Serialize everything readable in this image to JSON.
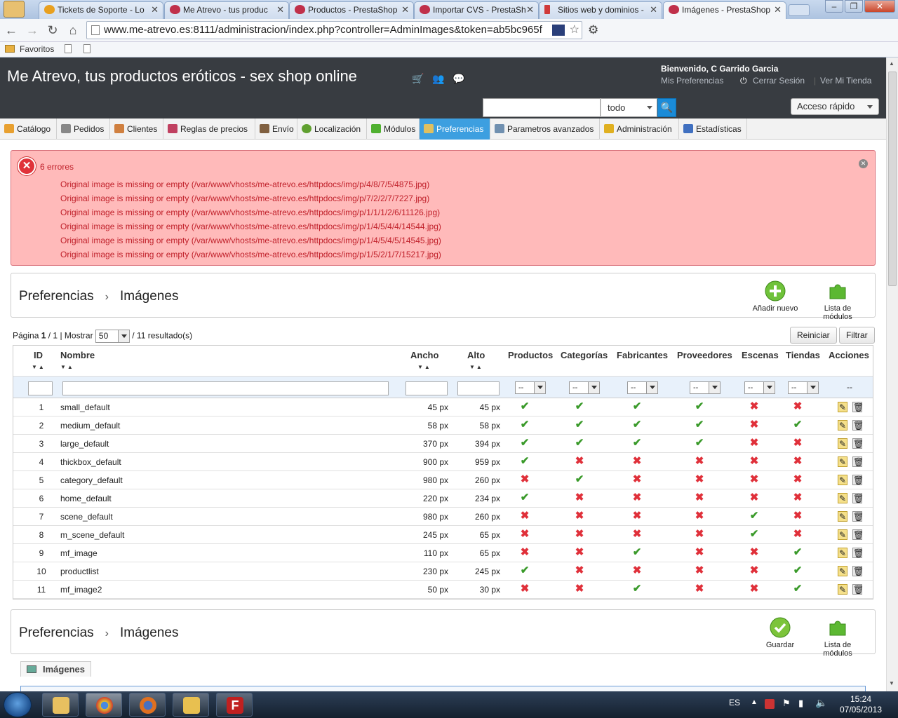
{
  "browser": {
    "tabs": [
      {
        "label": "Tickets de Soporte - Lo"
      },
      {
        "label": "Me Atrevo - tus produc"
      },
      {
        "label": "Productos - PrestaShop"
      },
      {
        "label": "Importar CVS - PrestaSh"
      },
      {
        "label": "Sitios web y dominios -"
      },
      {
        "label": "Imágenes - PrestaShop"
      }
    ],
    "url": "www.me-atrevo.es:8111/administracion/index.php?controller=AdminImages&token=ab5bc965f",
    "bookmarks_label": "Favoritos"
  },
  "header": {
    "title": "Me Atrevo, tus productos eróticos - sex shop online",
    "welcome_prefix": "Bienvenido, ",
    "welcome_name": "C Garrido Garcia",
    "my_prefs": "Mis Preferencias",
    "logout": "Cerrar Sesión",
    "view_store": "Ver Mi Tienda",
    "search_scope": "todo",
    "quick_access": "Acceso rápido"
  },
  "menu": [
    {
      "label": "Catálogo",
      "color": "#e8a030"
    },
    {
      "label": "Pedidos",
      "color": "#888888"
    },
    {
      "label": "Clientes",
      "color": "#d08040"
    },
    {
      "label": "Reglas de precios",
      "color": "#c04060"
    },
    {
      "label": "Envío",
      "color": "#806040"
    },
    {
      "label": "Localización",
      "color": "#60a030"
    },
    {
      "label": "Módulos",
      "color": "#50b030"
    },
    {
      "label": "Preferencias",
      "color": "#e0c060"
    },
    {
      "label": "Parametros avanzados",
      "color": "#7090b0"
    },
    {
      "label": "Administración",
      "color": "#e0b020"
    },
    {
      "label": "Estadísticas",
      "color": "#4070c0"
    }
  ],
  "errors": {
    "title": "6 errores",
    "lines": [
      "Original image is missing or empty (/var/www/vhosts/me-atrevo.es/httpdocs/img/p/4/8/7/5/4875.jpg)",
      "Original image is missing or empty (/var/www/vhosts/me-atrevo.es/httpdocs/img/p/7/2/2/7/7227.jpg)",
      "Original image is missing or empty (/var/www/vhosts/me-atrevo.es/httpdocs/img/p/1/1/1/2/6/11126.jpg)",
      "Original image is missing or empty (/var/www/vhosts/me-atrevo.es/httpdocs/img/p/1/4/5/4/4/14544.jpg)",
      "Original image is missing or empty (/var/www/vhosts/me-atrevo.es/httpdocs/img/p/1/4/5/4/5/14545.jpg)",
      "Original image is missing or empty (/var/www/vhosts/me-atrevo.es/httpdocs/img/p/1/5/2/1/7/15217.jpg)"
    ]
  },
  "toolbar_top": {
    "crumb1": "Preferencias",
    "crumb2": "Imágenes",
    "add_new": "Añadir nuevo",
    "modules_list": "Lista de módulos"
  },
  "toolbar_bottom": {
    "crumb1": "Preferencias",
    "crumb2": "Imágenes",
    "save": "Guardar",
    "modules_list": "Lista de módulos"
  },
  "pager": {
    "page_label": "Página",
    "page": "1",
    "pages": "1",
    "show_label": "Mostrar",
    "per_page": "50",
    "results": "/ 11 resultado(s)",
    "reset": "Reiniciar",
    "filter": "Filtrar"
  },
  "table": {
    "headers": {
      "id": "ID",
      "name": "Nombre",
      "width": "Ancho",
      "height": "Alto",
      "products": "Productos",
      "categories": "Categorías",
      "manufacturers": "Fabricantes",
      "suppliers": "Proveedores",
      "scenes": "Escenas",
      "stores": "Tiendas",
      "actions": "Acciones"
    },
    "filter_default": "--",
    "rows": [
      {
        "id": "1",
        "name": "small_default",
        "width": "45 px",
        "height": "45 px",
        "flags": [
          true,
          true,
          true,
          true,
          false,
          false
        ]
      },
      {
        "id": "2",
        "name": "medium_default",
        "width": "58 px",
        "height": "58 px",
        "flags": [
          true,
          true,
          true,
          true,
          false,
          true
        ]
      },
      {
        "id": "3",
        "name": "large_default",
        "width": "370 px",
        "height": "394 px",
        "flags": [
          true,
          true,
          true,
          true,
          false,
          false
        ]
      },
      {
        "id": "4",
        "name": "thickbox_default",
        "width": "900 px",
        "height": "959 px",
        "flags": [
          true,
          false,
          false,
          false,
          false,
          false
        ]
      },
      {
        "id": "5",
        "name": "category_default",
        "width": "980 px",
        "height": "260 px",
        "flags": [
          false,
          true,
          false,
          false,
          false,
          false
        ]
      },
      {
        "id": "6",
        "name": "home_default",
        "width": "220 px",
        "height": "234 px",
        "flags": [
          true,
          false,
          false,
          false,
          false,
          false
        ]
      },
      {
        "id": "7",
        "name": "scene_default",
        "width": "980 px",
        "height": "260 px",
        "flags": [
          false,
          false,
          false,
          false,
          true,
          false
        ]
      },
      {
        "id": "8",
        "name": "m_scene_default",
        "width": "245 px",
        "height": "65 px",
        "flags": [
          false,
          false,
          false,
          false,
          true,
          false
        ]
      },
      {
        "id": "9",
        "name": "mf_image",
        "width": "110 px",
        "height": "65 px",
        "flags": [
          false,
          false,
          true,
          false,
          false,
          true
        ]
      },
      {
        "id": "10",
        "name": "productlist",
        "width": "230 px",
        "height": "245 px",
        "flags": [
          true,
          false,
          false,
          false,
          false,
          true
        ]
      },
      {
        "id": "11",
        "name": "mf_image2",
        "width": "50 px",
        "height": "30 px",
        "flags": [
          false,
          false,
          true,
          false,
          false,
          true
        ]
      }
    ]
  },
  "section": {
    "title": "Imágenes"
  },
  "taskbar": {
    "lang": "ES",
    "time": "15:24",
    "date": "07/05/2013"
  },
  "colors": {
    "accent": "#3d9fe0",
    "header_bg": "#383c41",
    "error_bg": "#ffbaba",
    "ok": "#3a9a2a",
    "no": "#e0303a"
  }
}
